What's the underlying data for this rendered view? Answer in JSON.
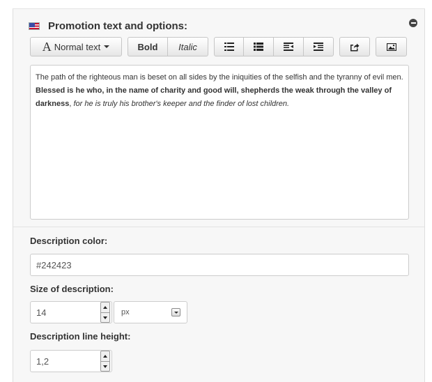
{
  "header": {
    "title": "Promotion text and options:",
    "flag_icon": "us-flag-icon",
    "collapse_icon": "minus-circle-icon"
  },
  "toolbar": {
    "normal_text": "Normal text",
    "normal_text_glyph": "A",
    "bold": "Bold",
    "italic": "Italic",
    "icons": [
      "unordered-list-icon",
      "ordered-list-icon",
      "outdent-icon",
      "indent-icon",
      "link-icon",
      "image-icon"
    ]
  },
  "editor": {
    "text_1": "The path of the righteous man is beset on all sides by the iniquities of the selfish and the tyranny of evil men. ",
    "text_bold": "Blessed is he who, in the name of charity and good will, shepherds the weak through the valley of darkness",
    "text_2": ", ",
    "text_italic": "for he is truly his brother's keeper and the finder of lost children."
  },
  "description_color": {
    "label": "Description color:",
    "value": "#242423"
  },
  "description_size": {
    "label": "Size of description:",
    "value": "14",
    "unit": "px"
  },
  "description_line_height": {
    "label": "Description line height:",
    "value": "1,2"
  }
}
